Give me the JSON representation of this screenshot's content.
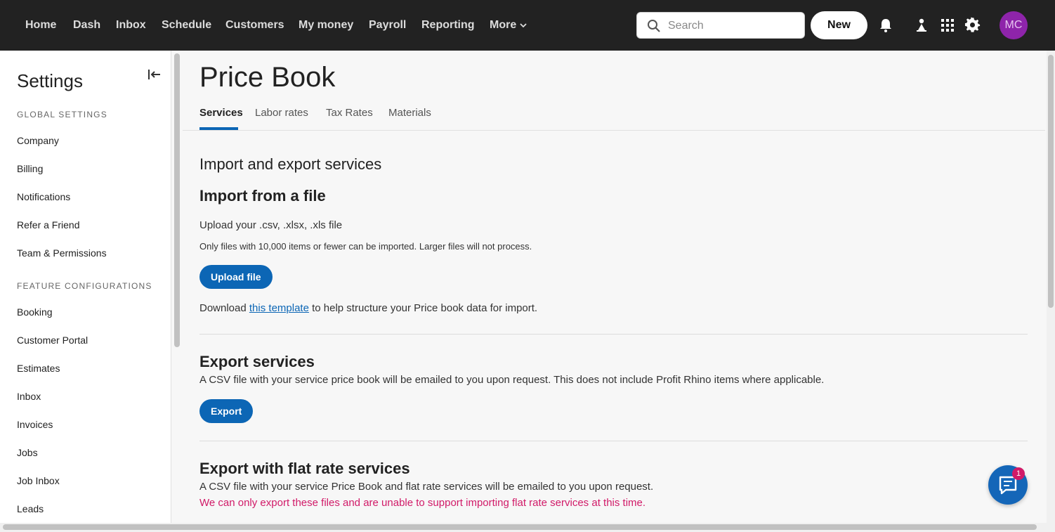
{
  "topnav": {
    "links": [
      "Home",
      "Dash",
      "Inbox",
      "Schedule",
      "Customers",
      "My money",
      "Payroll",
      "Reporting"
    ],
    "more_label": "More",
    "search_placeholder": "Search",
    "new_label": "New",
    "avatar_initials": "MC",
    "icons": [
      "bell-icon",
      "user-pin-icon",
      "apps-grid-icon",
      "gear-icon"
    ]
  },
  "sidebar": {
    "title": "Settings",
    "global_label": "GLOBAL SETTINGS",
    "global_items": [
      "Company",
      "Billing",
      "Notifications",
      "Refer a Friend",
      "Team & Permissions"
    ],
    "feature_label": "FEATURE CONFIGURATIONS",
    "feature_items": [
      "Booking",
      "Customer Portal",
      "Estimates",
      "Inbox",
      "Invoices",
      "Jobs",
      "Job Inbox",
      "Leads"
    ]
  },
  "main": {
    "title": "Price Book",
    "tabs": [
      "Services",
      "Labor rates",
      "Tax Rates",
      "Materials"
    ],
    "active_tab": "Services",
    "section_title": "Import and export services",
    "import": {
      "heading": "Import from a file",
      "upload_text": "Upload your .csv, .xlsx, .xls file",
      "limit_text": "Only files with 10,000 items or fewer can be imported. Larger files will not process.",
      "upload_button": "Upload file",
      "download_prefix": "Download ",
      "download_link": "this template",
      "download_suffix": " to help structure your Price book data for import."
    },
    "export": {
      "heading": "Export services",
      "text": "A CSV file with your service price book will be emailed to you upon request. This does not include Profit Rhino items where applicable.",
      "button": "Export"
    },
    "export_flat": {
      "heading": "Export with flat rate services",
      "text": "A CSV file with your service Price Book and flat rate services will be emailed to you upon request.",
      "warning": "We can only export these files and are unable to support importing flat rate services at this time."
    }
  },
  "chat": {
    "badge_count": "1"
  },
  "colors": {
    "accent": "#0c66b5",
    "warning": "#d11a68",
    "avatar": "#8e24aa",
    "topbar": "#222222"
  }
}
